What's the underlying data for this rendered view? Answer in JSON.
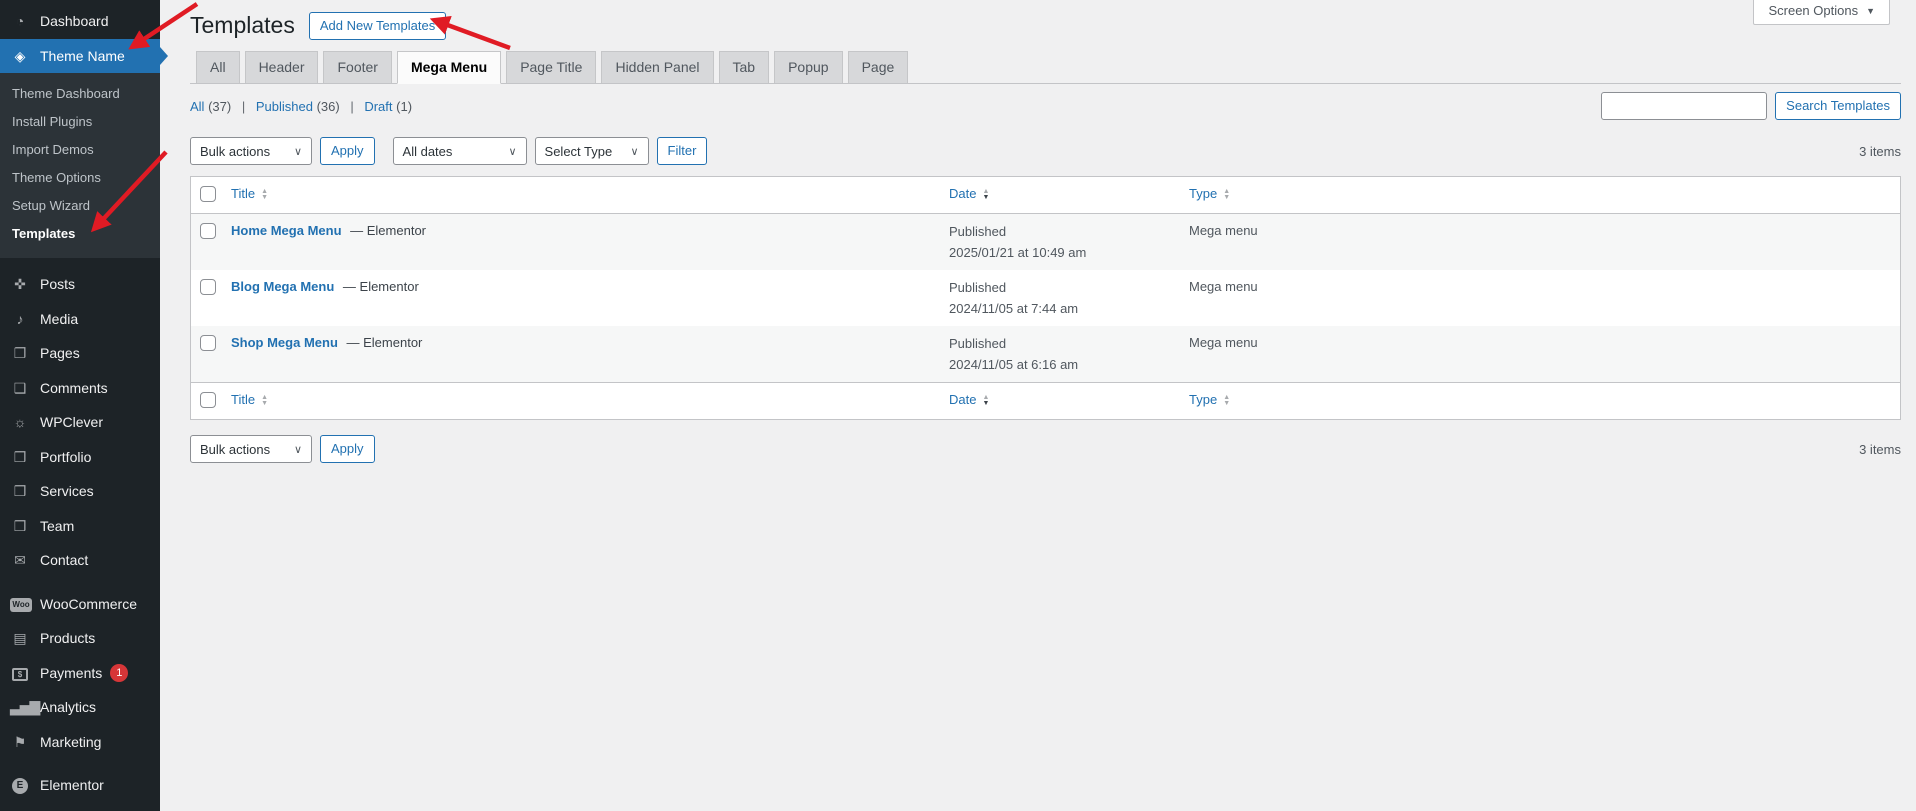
{
  "colors": {
    "accent": "#2271b1",
    "sidebar_bg": "#1d2327",
    "submenu_bg": "#2c3338",
    "badge_red": "#d63638",
    "annotation_arrow": "#e01b24",
    "page_bg": "#f0f0f1"
  },
  "screen_options": {
    "label": "Screen Options"
  },
  "page": {
    "heading": "Templates",
    "add_new_button": "Add New Templates"
  },
  "sidebar": {
    "dashboard": "Dashboard",
    "theme_name": "Theme Name",
    "theme_submenu": [
      "Theme Dashboard",
      "Install Plugins",
      "Import Demos",
      "Theme Options",
      "Setup Wizard",
      "Templates"
    ],
    "menu": [
      "Posts",
      "Media",
      "Pages",
      "Comments",
      "WPClever",
      "Portfolio",
      "Services",
      "Team",
      "Contact"
    ],
    "menu_woo": [
      "WooCommerce",
      "Products",
      "Payments",
      "Analytics",
      "Marketing"
    ],
    "menu_bottom": [
      "Elementor"
    ],
    "payments_badge": "1"
  },
  "tabs": [
    "All",
    "Header",
    "Footer",
    "Mega Menu",
    "Page Title",
    "Hidden Panel",
    "Tab",
    "Popup",
    "Page"
  ],
  "active_tab": "Mega Menu",
  "views": {
    "all": "All",
    "all_count": "(37)",
    "published": "Published",
    "published_count": "(36)",
    "draft": "Draft",
    "draft_count": "(1)",
    "separator": "|"
  },
  "search": {
    "value": "",
    "button": "Search Templates"
  },
  "toolbar": {
    "bulk_actions": "Bulk actions",
    "apply": "Apply",
    "all_dates": "All dates",
    "select_type": "Select Type",
    "filter": "Filter",
    "items_count": "3 items"
  },
  "table": {
    "columns": {
      "title": "Title",
      "date": "Date",
      "type": "Type"
    },
    "rows": [
      {
        "title": "Home Mega Menu",
        "suffix": "— Elementor",
        "status": "Published",
        "date": "2025/01/21 at 10:49 am",
        "type": "Mega menu"
      },
      {
        "title": "Blog Mega Menu",
        "suffix": "— Elementor",
        "status": "Published",
        "date": "2024/11/05 at 7:44 am",
        "type": "Mega menu"
      },
      {
        "title": "Shop Mega Menu",
        "suffix": "— Elementor",
        "status": "Published",
        "date": "2024/11/05 at 6:16 am",
        "type": "Mega menu"
      }
    ]
  },
  "icons": {
    "dashboard": "◔",
    "theme": "◈",
    "posts": "✜",
    "media": "♪",
    "pages": "❐",
    "comments": "❑",
    "wpclever": "☼",
    "portfolio": "❒",
    "services": "❒",
    "team": "❒",
    "contact": "✉",
    "woocommerce": "Woo",
    "products": "▤",
    "payments": "$",
    "analytics": "▃▅▇",
    "marketing": "⚑",
    "elementor": "E",
    "screen_options_caret": "▼",
    "select_caret": "∨",
    "sort_up": "▲",
    "sort_down": "▼"
  }
}
